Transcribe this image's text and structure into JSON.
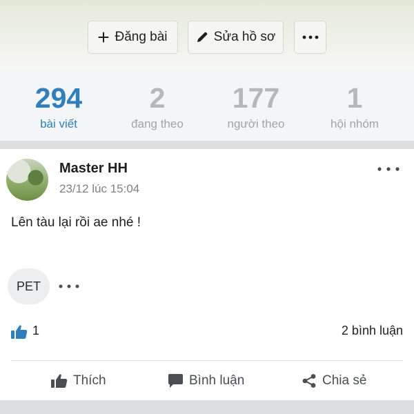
{
  "toolbar": {
    "post_label": "Đăng bài",
    "edit_profile_label": "Sửa hồ sơ",
    "more_icon": "ellipsis-icon"
  },
  "stats": [
    {
      "value": "294",
      "label": "bài viết",
      "active": true
    },
    {
      "value": "2",
      "label": "đang theo",
      "active": false
    },
    {
      "value": "177",
      "label": "người theo",
      "active": false
    },
    {
      "value": "1",
      "label": "hội nhóm",
      "active": false
    }
  ],
  "post": {
    "author": "Master HH",
    "timestamp": "23/12 lúc 15:04",
    "content": "Lên tàu lại rồi ae nhé !",
    "tag": "PET",
    "like_count": "1",
    "comment_count": "2 bình luận",
    "actions": {
      "like": "Thích",
      "comment": "Bình luận",
      "share": "Chia sẻ"
    }
  },
  "colors": {
    "accent": "#2f7fbc",
    "muted_text": "#a0a4aa"
  }
}
